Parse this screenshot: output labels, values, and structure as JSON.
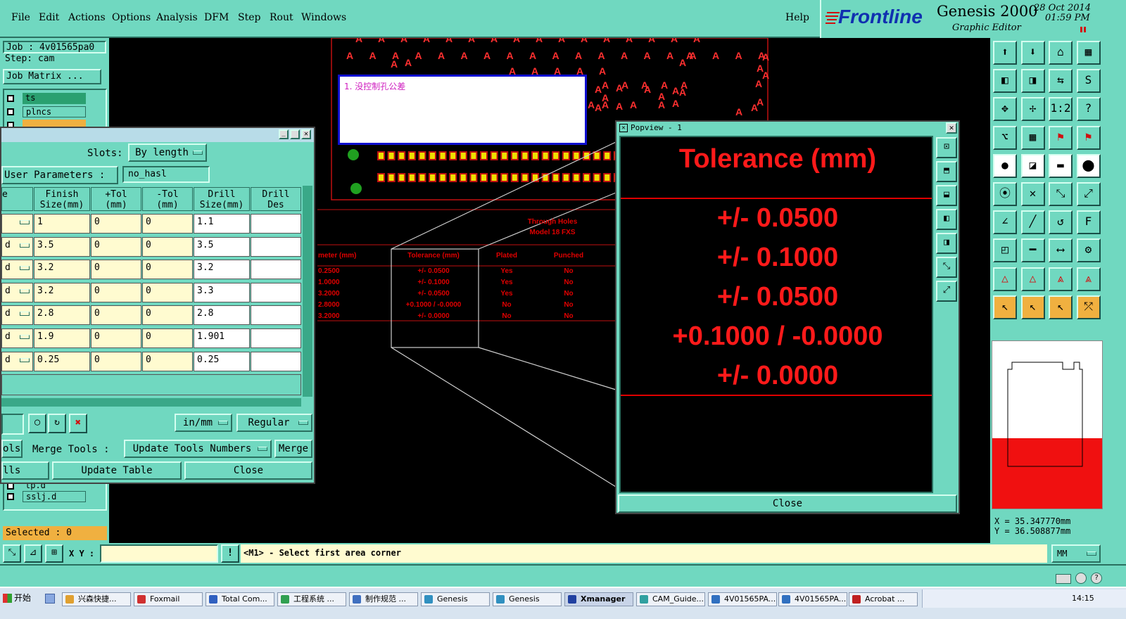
{
  "menu": {
    "items": [
      "File",
      "Edit",
      "Actions",
      "Options",
      "Analysis",
      "DFM",
      "Step",
      "Rout",
      "Windows"
    ],
    "help": "Help"
  },
  "logo": {
    "brand": "Frontline",
    "product": "Genesis 2000",
    "subtitle": "Graphic Editor",
    "date": "28 Oct 2014",
    "time": "01:59 PM"
  },
  "left": {
    "job": "Job : 4v01565pa0",
    "step": "Step: cam",
    "job_matrix": "Job Matrix ...",
    "layers_top": [
      "ts",
      "plncs"
    ],
    "layers_bottom": [
      "tp.d",
      "sslj.d"
    ],
    "selected": "Selected : 0"
  },
  "canvas": {
    "note": "1. 没控制孔公差",
    "table_title": "Through Holes",
    "table_subtitle": "Model 18 FXS",
    "headers": [
      "meter (mm)",
      "Tolerance (mm)",
      "Plated",
      "Punched"
    ],
    "rows": [
      [
        "0.2500",
        "+/- 0.0500",
        "Yes",
        "No"
      ],
      [
        "1.0000",
        "+/- 0.1000",
        "Yes",
        "No"
      ],
      [
        "3.2000",
        "+/- 0.0500",
        "Yes",
        "No"
      ],
      [
        "2.8000",
        "+0.1000 / -0.0000",
        "No",
        "No"
      ],
      [
        "3.2000",
        "+/- 0.0000",
        "No",
        "No"
      ]
    ]
  },
  "drill": {
    "slots_label": "Slots:",
    "slots_value": "By length",
    "user_params_label": "User Parameters :",
    "user_params_value": "no_hasl",
    "col_headers": [
      "e",
      "Finish\nSize(mm)",
      "+Tol\n(mm)",
      "-Tol\n(mm)",
      "Drill\nSize(mm)",
      "Drill\nDes"
    ],
    "rows": [
      {
        "type": "",
        "finish": "1",
        "ptol": "0",
        "ntol": "0",
        "drill": "1.1"
      },
      {
        "type": "d",
        "finish": "3.5",
        "ptol": "0",
        "ntol": "0",
        "drill": "3.5"
      },
      {
        "type": "d",
        "finish": "3.2",
        "ptol": "0",
        "ntol": "0",
        "drill": "3.2"
      },
      {
        "type": "d",
        "finish": "3.2",
        "ptol": "0",
        "ntol": "0",
        "drill": "3.3"
      },
      {
        "type": "d",
        "finish": "2.8",
        "ptol": "0",
        "ntol": "0",
        "drill": "2.8"
      },
      {
        "type": "d",
        "finish": "1.9",
        "ptol": "0",
        "ntol": "0",
        "drill": "1.901"
      },
      {
        "type": "d",
        "finish": "0.25",
        "ptol": "0",
        "ntol": "0",
        "drill": "0.25"
      }
    ],
    "units": "in/mm",
    "mode": "Regular",
    "tools_label": "ols",
    "merge_tools_label": "Merge Tools :",
    "update_tools_numbers": "Update Tools Numbers",
    "merge": "Merge",
    "lls": "lls",
    "update_table": "Update Table",
    "close": "Close"
  },
  "popview": {
    "title": "Popview - 1",
    "heading": "Tolerance (mm)",
    "values": [
      "+/- 0.0500",
      "+/- 0.1000",
      "+/- 0.0500",
      "+0.1000 / -0.0000",
      "+/- 0.0000"
    ],
    "close": "Close"
  },
  "coords": {
    "x": "X = 35.347770mm",
    "y": "Y = 36.508877mm"
  },
  "cmd": {
    "xy_label": "X Y :",
    "xy_value": "",
    "prompt": "<M1> - Select first area corner",
    "units": "MM"
  },
  "taskbar": {
    "start": "开始",
    "tasks": [
      "兴森快捷...",
      "Foxmail",
      "Total Com...",
      "工程系统 ...",
      "制作规范 ...",
      "Genesis",
      "Genesis",
      "Xmanager",
      "CAM_Guide...",
      "4V01565PA...",
      "4V01565PA...",
      "Acrobat ..."
    ],
    "clock": "14:15"
  },
  "colors": {
    "panel": "#70d8c0",
    "accent_red": "#e00000",
    "pad_yellow": "#f0e000"
  }
}
